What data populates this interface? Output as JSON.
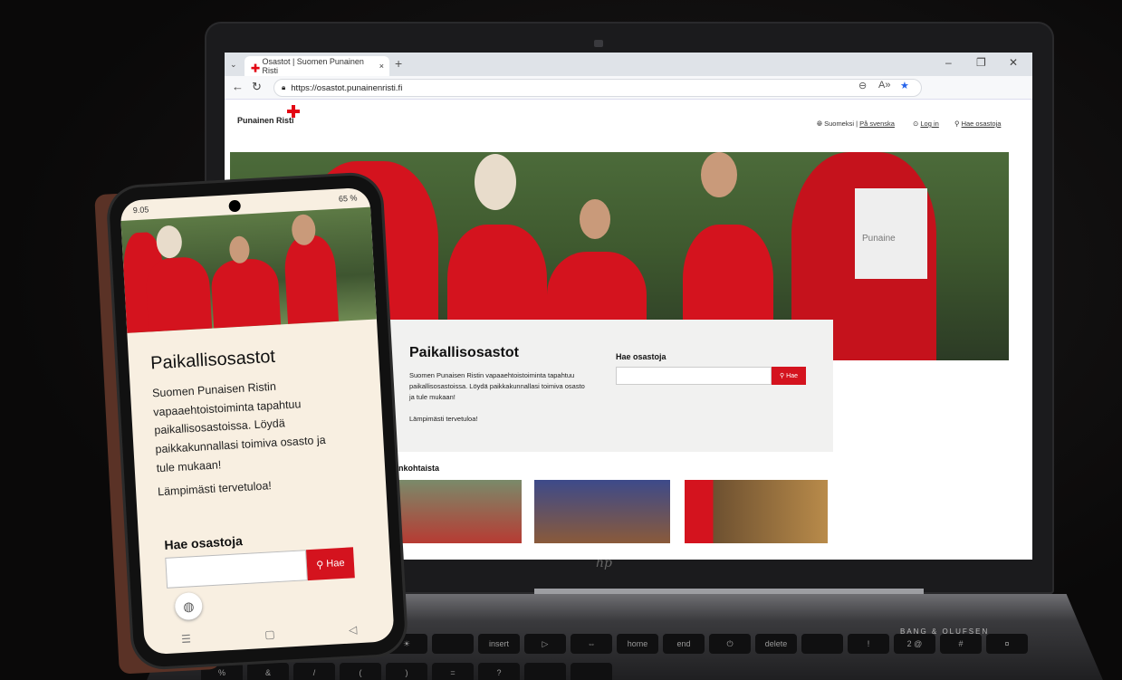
{
  "laptop": {
    "browser": {
      "tab_list_icon": "chevron-down-icon",
      "tab_title": "Osastot | Suomen Punainen Risti",
      "tab_close": "×",
      "new_tab": "+",
      "window_controls": [
        "–",
        "❐",
        "✕"
      ],
      "url": "https://osastot.punainenristi.fi"
    },
    "site": {
      "logo_text": "Punainen Risti",
      "lang_current": "Suomeksi",
      "lang_separator": "|",
      "lang_other": "På svenska",
      "login": "Log in",
      "search_link": "Hae osastoja",
      "title": "Paikallisosastot",
      "intro": "Suomen Punaisen Ristin vapaaehtoistoiminta tapahtuu paikallisosastoissa. Löydä paikkakunnallasi toimiva osasto ja tule mukaan!",
      "welcome": "Lämpimästi tervetuloa!",
      "search_label": "Hae osastoja",
      "search_button": "Hae",
      "news_heading": "Ajankohtaista",
      "vest_text": "Punaine"
    },
    "brand": "BANG & OLUFSEN",
    "keys": [
      "*",
      "☀",
      "◁",
      "◁))",
      "☀",
      "",
      "insert",
      "▷",
      "⇔",
      "home",
      "end",
      "⏻",
      "delete",
      "",
      "!",
      "2 @",
      "#",
      "¤",
      "%",
      "&",
      "/",
      "(",
      ")",
      "=",
      "?",
      "",
      ""
    ]
  },
  "phone": {
    "time": "9.05",
    "status_right": "65 %",
    "title": "Paikallisosastot",
    "intro": "Suomen Punaisen Ristin vapaaehtoistoiminta tapahtuu paikallisosastoissa. Löydä paikkakunnallasi toimiva osasto ja tule mukaan!",
    "welcome": "Lämpimästi tervetuloa!",
    "search_label": "Hae osastoja",
    "search_button": "Hae",
    "nav": [
      "☰",
      "▢",
      "◁"
    ]
  },
  "colors": {
    "brand_red": "#d4131e",
    "cross_red": "#e30613"
  }
}
